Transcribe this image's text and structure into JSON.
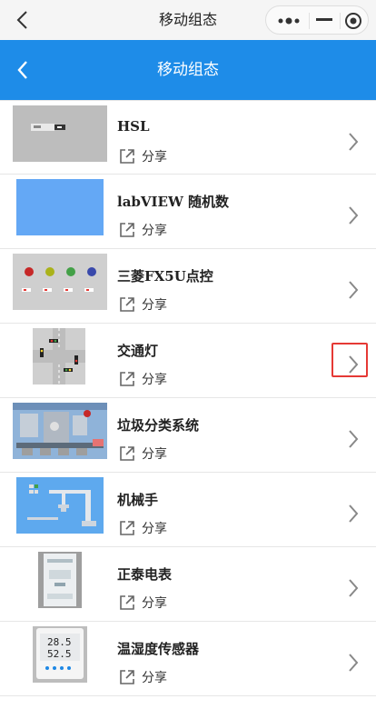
{
  "wechat_bar": {
    "title": "移动组态"
  },
  "header": {
    "title": "移动组态"
  },
  "items": [
    {
      "name": "HSL",
      "share_label": "分享",
      "thumb": "hsl-thumbnail"
    },
    {
      "name": "labVIEW 随机数",
      "share_label": "分享",
      "thumb": "blue-thumbnail"
    },
    {
      "name": "三菱FX5U点控",
      "share_label": "分享",
      "thumb": "indicator-lights-thumbnail"
    },
    {
      "name": "交通灯",
      "share_label": "分享",
      "thumb": "traffic-light-thumbnail",
      "highlighted": true
    },
    {
      "name": "垃圾分类系统",
      "share_label": "分享",
      "thumb": "garbage-sorting-thumbnail"
    },
    {
      "name": "机械手",
      "share_label": "分享",
      "thumb": "robot-arm-thumbnail"
    },
    {
      "name": "正泰电表",
      "share_label": "分享",
      "thumb": "electric-meter-thumbnail"
    },
    {
      "name": "温湿度传感器",
      "share_label": "分享",
      "thumb": "temp-humidity-sensor-thumbnail",
      "readings": [
        "28.5",
        "52.5"
      ]
    }
  ],
  "colors": {
    "header_blue": "#1e8ce8",
    "highlight_red": "#e53935"
  }
}
